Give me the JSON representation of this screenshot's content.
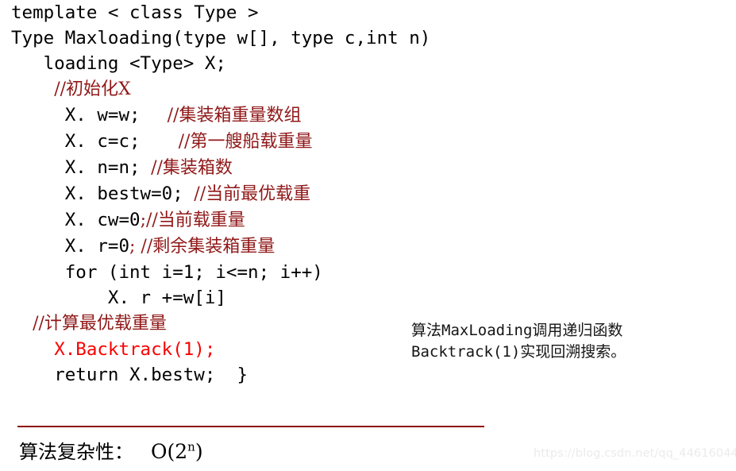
{
  "code": {
    "lines": [
      {
        "indent": 0,
        "segments": [
          {
            "kind": "code",
            "text": "template < class Type >"
          }
        ]
      },
      {
        "indent": 0,
        "segments": [
          {
            "kind": "code",
            "text": "Type Maxloading(type w[], type c,int n)"
          }
        ]
      },
      {
        "indent": 3,
        "segments": [
          {
            "kind": "code",
            "text": "loading <Type> X;"
          }
        ]
      },
      {
        "indent": 4,
        "segments": [
          {
            "kind": "comment",
            "text": "//初始化X"
          }
        ]
      },
      {
        "indent": 5,
        "segments": [
          {
            "kind": "code",
            "text": "X. w=w;  "
          },
          {
            "kind": "comment",
            "text": " //集装箱重量数组"
          }
        ]
      },
      {
        "indent": 5,
        "segments": [
          {
            "kind": "code",
            "text": "X. c=c;  "
          },
          {
            "kind": "comment",
            "text": "   //第一艘船载重量"
          }
        ]
      },
      {
        "indent": 5,
        "segments": [
          {
            "kind": "code",
            "text": "X. n=n; "
          },
          {
            "kind": "comment",
            "text": "//集装箱数"
          }
        ]
      },
      {
        "indent": 5,
        "segments": [
          {
            "kind": "code",
            "text": "X. bestw=0; "
          },
          {
            "kind": "comment",
            "text": "//当前最优载重"
          }
        ]
      },
      {
        "indent": 5,
        "segments": [
          {
            "kind": "code",
            "text": "X. cw=0"
          },
          {
            "kind": "comment",
            "text": ";//当前载重量"
          }
        ]
      },
      {
        "indent": 5,
        "segments": [
          {
            "kind": "code",
            "text": "X. r=0"
          },
          {
            "kind": "comment",
            "text": "; //剩余集装箱重量"
          }
        ]
      },
      {
        "indent": 5,
        "segments": [
          {
            "kind": "code",
            "text": "for (int i=1; i<=n; i++)"
          }
        ]
      },
      {
        "indent": 9,
        "segments": [
          {
            "kind": "code",
            "text": "X. r +=w[i]"
          }
        ]
      },
      {
        "indent": 2,
        "segments": [
          {
            "kind": "comment",
            "text": "//计算最优载重量"
          }
        ]
      },
      {
        "indent": 4,
        "segments": [
          {
            "kind": "red",
            "text": "X.Backtrack(1);"
          }
        ]
      },
      {
        "indent": 4,
        "segments": [
          {
            "kind": "code",
            "text": "return X.bestw;  }"
          }
        ]
      }
    ]
  },
  "annotation": {
    "lines": [
      "算法MaxLoading调用递归函数",
      "Backtrack(1)实现回溯搜索。"
    ]
  },
  "footer": {
    "complexity_label": "算法复杂性：",
    "complexity_base": "O(2",
    "complexity_exp": "n",
    "complexity_close": ")"
  },
  "watermark": {
    "text": "https://blog.csdn.net/qq_44616044"
  },
  "colors": {
    "code": "#000000",
    "comment": "#901818",
    "highlight": "#fa0000",
    "rule": "#8d0c0c",
    "watermark": "#ebebeb",
    "background": "#ffffff"
  }
}
